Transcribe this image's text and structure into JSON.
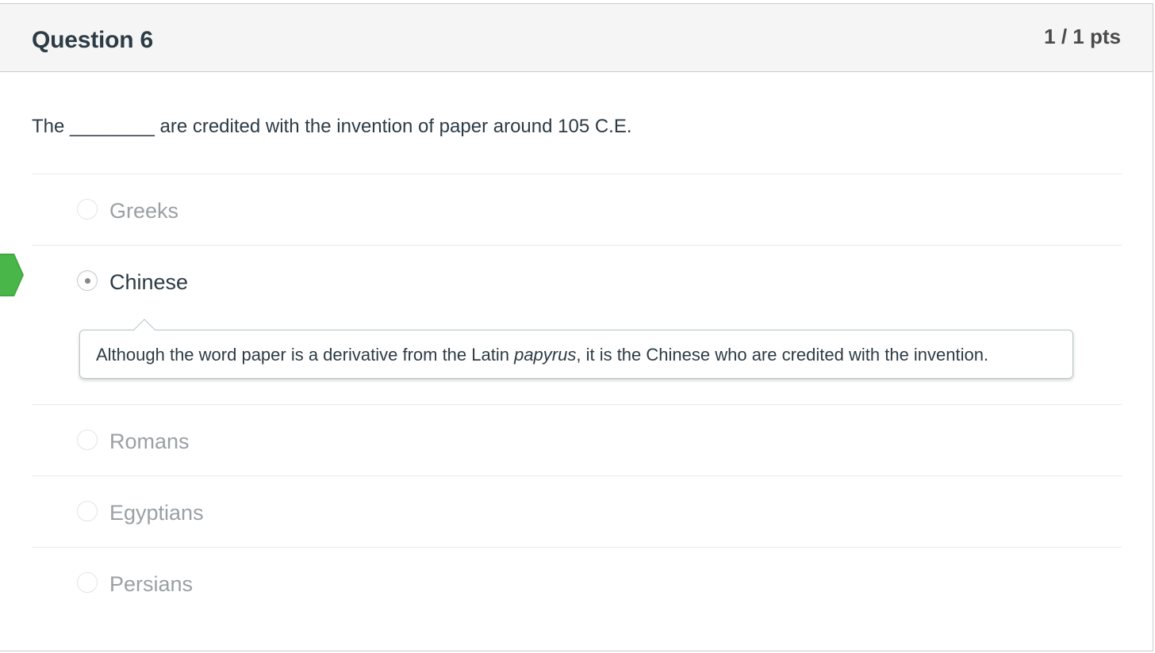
{
  "question": {
    "title": "Question 6",
    "points": "1 / 1 pts",
    "text": "The ________ are credited with the invention of paper around 105 C.E."
  },
  "answers": [
    {
      "label": "Greeks",
      "selected": false
    },
    {
      "label": "Chinese",
      "selected": true,
      "correct": true
    },
    {
      "label": "Romans",
      "selected": false
    },
    {
      "label": "Egyptians",
      "selected": false
    },
    {
      "label": "Persians",
      "selected": false
    }
  ],
  "comment": {
    "before": "Although the word paper is a derivative from the Latin ",
    "emphasis": "papyrus",
    "after": ", it is the Chinese who are credited with the invention."
  },
  "colors": {
    "correct_marker": "#3fa83f",
    "header_bg": "#f5f5f5",
    "text": "#2d3b45",
    "muted_text": "#9aa0a4"
  },
  "icons": {
    "correct_marker": "correct-answer-arrow-icon",
    "selected_radio": "radio-selected-icon",
    "unselected_radio": "radio-unselected-icon"
  }
}
